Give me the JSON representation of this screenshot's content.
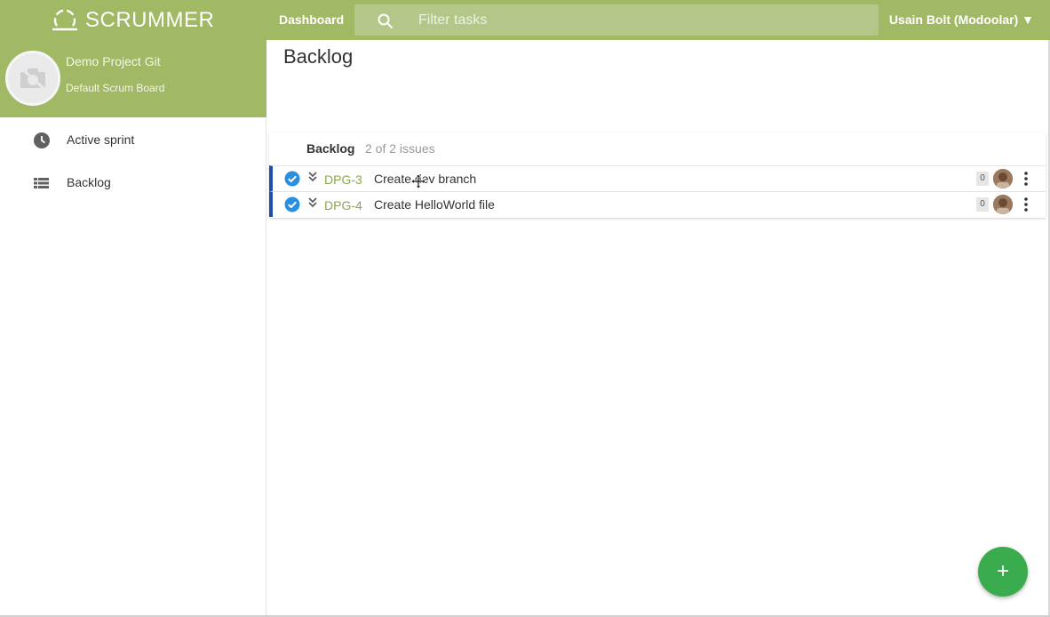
{
  "header": {
    "logo_text": "SCRUMMER",
    "dashboard_label": "Dashboard",
    "search_placeholder": "Filter tasks",
    "user_label": "Usain Bolt (Modoolar) ▼"
  },
  "sidebar": {
    "project_name": "Demo Project Git",
    "board_name": "Default Scrum Board",
    "items": [
      {
        "label": "Active sprint",
        "icon": "clock-icon"
      },
      {
        "label": "Backlog",
        "icon": "list-icon"
      }
    ]
  },
  "main": {
    "title": "Backlog",
    "backlog": {
      "title": "Backlog",
      "count_text": "2 of 2 issues",
      "issues": [
        {
          "key": "DPG-3",
          "summary": "Create dev branch",
          "points": "0"
        },
        {
          "key": "DPG-4",
          "summary": "Create HelloWorld file",
          "points": "0"
        }
      ]
    },
    "fab_label": "+"
  },
  "colors": {
    "brand": "#a1b864",
    "issue_key": "#8aa84a",
    "issue_border": "#1e4ea8",
    "check": "#2b8fe0",
    "fab": "#3aac4e"
  }
}
